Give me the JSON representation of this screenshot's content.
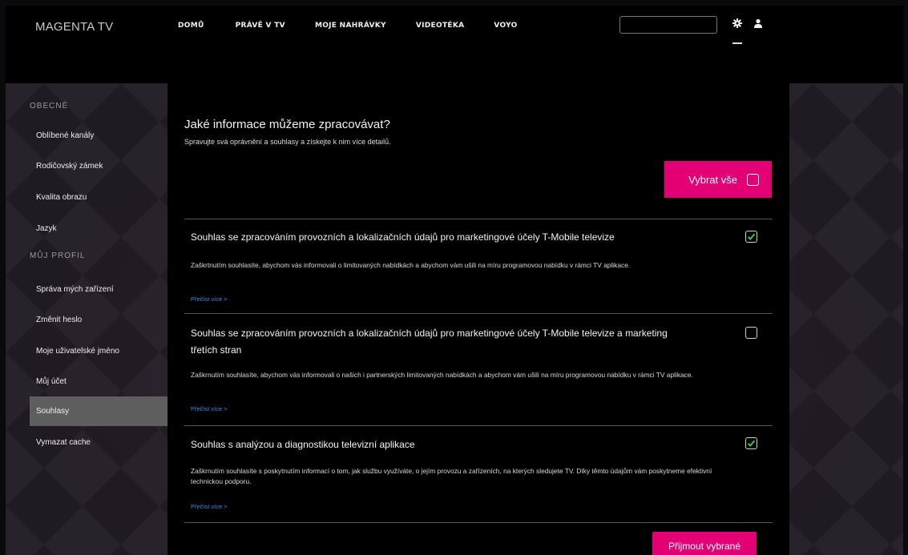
{
  "app": {
    "brand": "MAGENTA TV"
  },
  "nav": {
    "items": [
      "DOMŮ",
      "PRÁVĚ V TV",
      "MOJE NAHRÁVKY",
      "VIDEOTÉKA",
      "VOYO"
    ]
  },
  "header": {
    "search": {
      "value": "",
      "placeholder": ""
    },
    "icons": [
      "gear-icon",
      "user-icon"
    ]
  },
  "sidebar": {
    "sections": [
      {
        "title": "OBECNÉ",
        "items": [
          "Oblíbené kanály",
          "Rodičovský zámek",
          "Kvalita obrazu",
          "Jazyk"
        ]
      },
      {
        "title": "MŮJ PROFIL",
        "items": [
          "Správa mých zařízení",
          "Změnit heslo",
          "Moje uživatelské jméno",
          "Můj účet",
          "Souhlasy",
          "Vymazat cache"
        ]
      }
    ],
    "active": "Souhlasy"
  },
  "main": {
    "title": "Jaké informace můžeme zpracovávat?",
    "subtitle": "Spravujte svá oprávnění a souhlasy a získejte k nim více detailů.",
    "select_all_label": "Vybrat vše",
    "select_all_checked": false,
    "consents": [
      {
        "title": "Souhlas se zpracováním provozních a lokalizačních údajů pro marketingové účely T-Mobile televize",
        "description": "Zaškrtnutím souhlasíte, abychom vás informovali o limitovaných nabídkách a abychom vám ušili na míru programovou nabídku v rámci TV aplikace.",
        "link": "Přečíst více >",
        "checked": true
      },
      {
        "title": "Souhlas se zpracováním provozních a lokalizačních údajů pro marketingové účely T-Mobile televize a marketing třetích stran",
        "description": "Zaškrnutím souhlasíte, abychom vás informovali o našich i partnerských limitovaných nabídkách a abychom vám ušili na míru programovou nabídku v rámci TV aplikace.",
        "link": "Přečíst více >",
        "checked": false
      },
      {
        "title": "Souhlas s analýzou a diagnostikou televizní aplikace",
        "description": "Zaškrnutím souhlasíte s poskytnutím informací o tom, jak službu využíváte, o jejím provozu a zařízeních, na kterých sledujete TV. Díky těmto údajům vám poskytneme efektivní technickou podporu.",
        "link": "Přečíst více >",
        "checked": true
      }
    ],
    "accept_label": "Přijmout vybrané"
  },
  "colors": {
    "accent": "#e20074",
    "link": "#3f8ee6",
    "check": "#4fc84f",
    "sidebar_active": "#5e5e5e"
  }
}
